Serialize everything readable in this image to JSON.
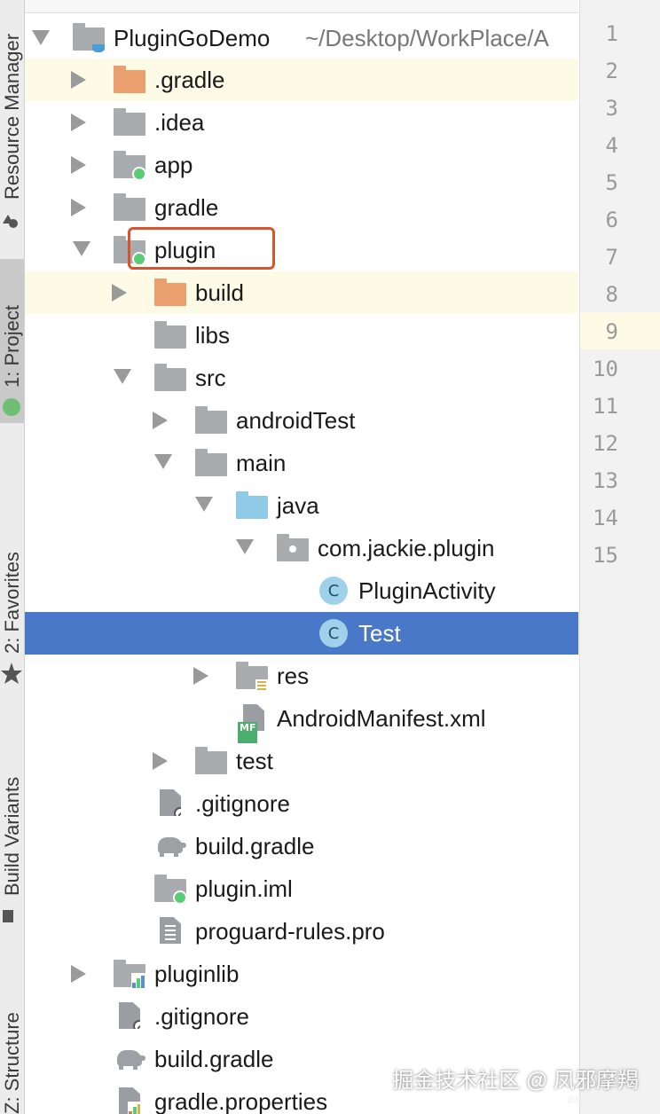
{
  "toolwindows": [
    {
      "label": "Resource Manager"
    },
    {
      "label": "1: Project"
    },
    {
      "label": "2: Favorites"
    },
    {
      "label": "Build Variants"
    },
    {
      "label": "Z: Structure"
    }
  ],
  "tree": {
    "root": {
      "name": "PluginGoDemo",
      "path": "~/Desktop/WorkPlace/A"
    },
    "items": [
      {
        "label": ".gradle"
      },
      {
        "label": ".idea"
      },
      {
        "label": "app"
      },
      {
        "label": "gradle"
      },
      {
        "label": "plugin"
      },
      {
        "label": "build"
      },
      {
        "label": "libs"
      },
      {
        "label": "src"
      },
      {
        "label": "androidTest"
      },
      {
        "label": "main"
      },
      {
        "label": "java"
      },
      {
        "label": "com.jackie.plugin"
      },
      {
        "label": "PluginActivity"
      },
      {
        "label": "Test"
      },
      {
        "label": "res"
      },
      {
        "label": "AndroidManifest.xml"
      },
      {
        "label": "test"
      },
      {
        "label": ".gitignore"
      },
      {
        "label": "build.gradle"
      },
      {
        "label": "plugin.iml"
      },
      {
        "label": "proguard-rules.pro"
      },
      {
        "label": "pluginlib"
      },
      {
        "label": ".gitignore"
      },
      {
        "label": "build.gradle"
      },
      {
        "label": "gradle.properties"
      }
    ],
    "class_badge": "C",
    "manifest_badge": "MF"
  },
  "gutter": {
    "line_numbers": [
      "1",
      "2",
      "3",
      "4",
      "5",
      "6",
      "7",
      "8",
      "9",
      "10",
      "11",
      "12",
      "13",
      "14",
      "15"
    ]
  },
  "watermark": {
    "text": "掘金技术社区 @ 凤邪摩羯",
    "sub": "@稀土掘金技术社区"
  },
  "colors": {
    "selection": "#4a78c8",
    "highlight": "#fdfbe6",
    "annotation": "#d9542b"
  }
}
